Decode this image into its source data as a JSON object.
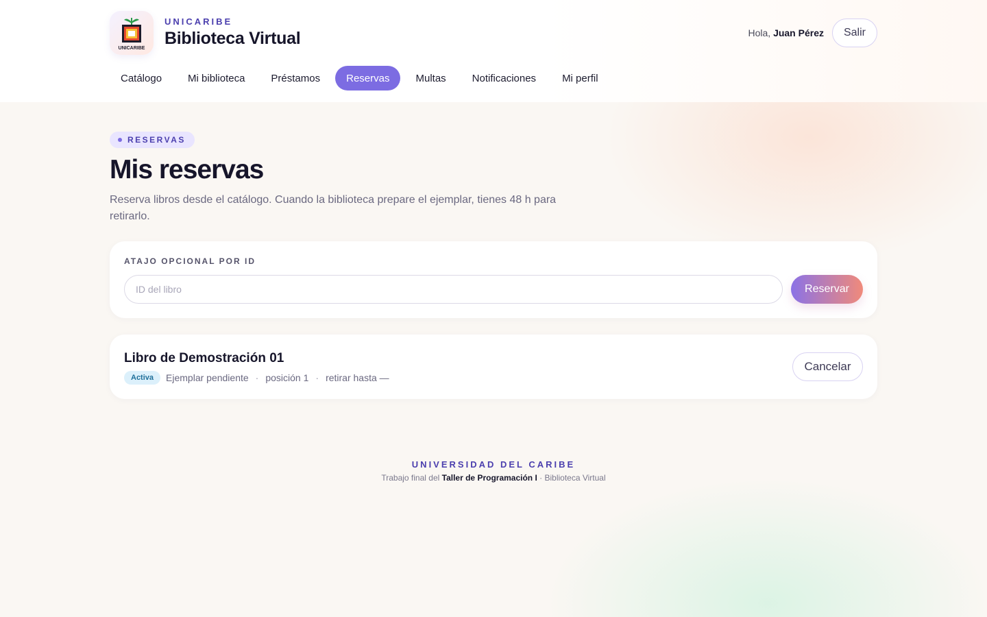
{
  "header": {
    "logo_text": "UNICARIBE",
    "brand_kicker": "UNICARIBE",
    "brand_title": "Biblioteca Virtual",
    "greeting_prefix": "Hola,",
    "user_name": "Juan Pérez",
    "logout_label": "Salir"
  },
  "nav": {
    "items": [
      {
        "label": "Catálogo"
      },
      {
        "label": "Mi biblioteca"
      },
      {
        "label": "Préstamos"
      },
      {
        "label": "Reservas",
        "active": true
      },
      {
        "label": "Multas"
      },
      {
        "label": "Notificaciones"
      },
      {
        "label": "Mi perfil"
      }
    ]
  },
  "page": {
    "kicker": "RESERVAS",
    "title": "Mis reservas",
    "description": "Reserva libros desde el catálogo. Cuando la biblioteca prepare el ejemplar, tienes 48 h para retirarlo."
  },
  "shortcut": {
    "label": "ATAJO OPCIONAL POR ID",
    "input_value": "",
    "input_placeholder": "ID del libro",
    "button_label": "Reservar"
  },
  "reservations": [
    {
      "title": "Libro de Demostración 01",
      "status": "Activa",
      "copy_status": "Ejemplar pendiente",
      "position": "posición 1",
      "pickup": "retirar hasta —",
      "cancel_label": "Cancelar"
    }
  ],
  "footer": {
    "title": "UNIVERSIDAD DEL CARIBE",
    "sub_prefix": "Trabajo final del",
    "sub_strong": "Taller de Programación I",
    "sub_suffix": "· Biblioteca Virtual"
  },
  "colors": {
    "accent": "#7c6ce2",
    "brand_text": "#4b3fae",
    "badge_bg": "#dcf0fb",
    "gradient_start": "#8b72e6",
    "gradient_end": "#f08a7a"
  },
  "icons": {
    "logo": "unicaribe-logo",
    "pill_dot": "dot-icon"
  }
}
